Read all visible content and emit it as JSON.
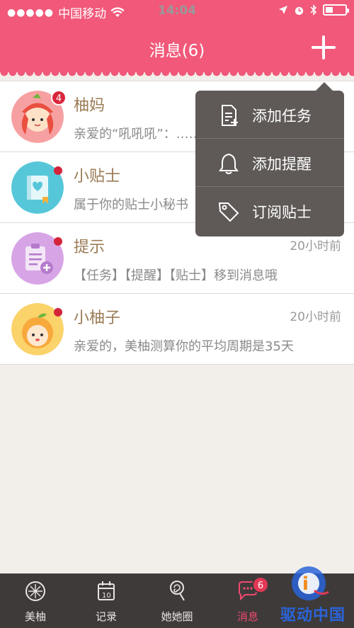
{
  "status": {
    "carrier": "中国移动",
    "time": "14:04"
  },
  "nav": {
    "title": "消息(6)"
  },
  "messages": [
    {
      "name": "柚妈",
      "badge": "4",
      "time": "",
      "preview": "亲爱的“吼吼吼”：……"
    },
    {
      "name": "小贴士",
      "time": "",
      "preview": "属于你的贴士小秘书"
    },
    {
      "name": "提示",
      "time": "20小时前",
      "preview": "【任务】【提醒】【贴士】移到消息哦"
    },
    {
      "name": "小柚子",
      "time": "20小时前",
      "preview": "亲爱的，美柚测算你的平均周期是35天"
    }
  ],
  "popup": {
    "items": [
      {
        "label": "添加任务",
        "icon": "document-add-icon"
      },
      {
        "label": "添加提醒",
        "icon": "bell-icon"
      },
      {
        "label": "订阅贴士",
        "icon": "tag-icon"
      }
    ]
  },
  "tabbar": {
    "tabs": [
      {
        "label": "美柚",
        "icon": "grapefruit-icon"
      },
      {
        "label": "记录",
        "icon": "calendar-icon"
      },
      {
        "label": "她她圈",
        "icon": "lollipop-icon"
      },
      {
        "label": "消息",
        "icon": "chat-icon",
        "badge": "6",
        "active": true
      },
      {
        "label": "",
        "icon": "more-icon"
      }
    ]
  },
  "watermark": {
    "text": "驱动中国"
  },
  "colors": {
    "accent": "#f1587a",
    "tabbar": "#3e3a3a",
    "popup": "#5f5a57",
    "badge": "#d9263d"
  }
}
